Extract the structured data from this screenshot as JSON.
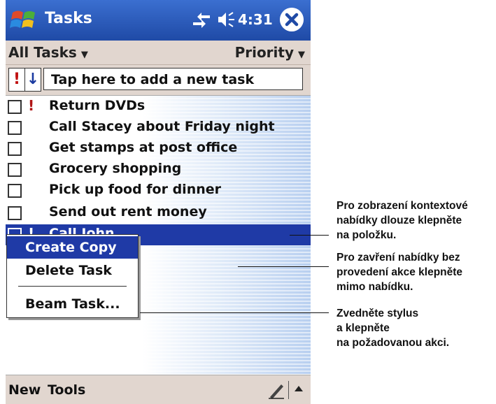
{
  "title_bar": {
    "app_title": "Tasks",
    "clock": "4:31",
    "accent": "#1f4aa6"
  },
  "filter_bar": {
    "category": "All Tasks",
    "sort": "Priority"
  },
  "entry_bar": {
    "priority_label": "!",
    "sort_label": "↓",
    "new_task_placeholder": "Tap here to add a new task"
  },
  "tasks": [
    {
      "label": "Return DVDs",
      "priority": "!"
    },
    {
      "label": "Call Stacey about Friday night",
      "priority": ""
    },
    {
      "label": "Get stamps at post office",
      "priority": ""
    },
    {
      "label": "Grocery shopping",
      "priority": ""
    },
    {
      "label": "Pick up food for dinner",
      "priority": ""
    },
    {
      "label": "Send out rent money",
      "priority": ""
    },
    {
      "label": "Call John",
      "priority": "!"
    }
  ],
  "context_menu": {
    "items": [
      "Create Copy",
      "Delete Task",
      "Beam Task..."
    ]
  },
  "bottom_bar": {
    "new_label": "New",
    "tools_label": "Tools"
  },
  "callouts": [
    {
      "lines": [
        "Pro zobrazení kontextové",
        "nabídky dlouze klepněte",
        "na položku."
      ]
    },
    {
      "lines": [
        "Pro zavření nabídky bez",
        "provedení akce klepněte",
        "mimo nabídku."
      ]
    },
    {
      "lines": [
        "Zvedněte stylus",
        "a klepněte",
        "na požadovanou akci."
      ]
    }
  ]
}
